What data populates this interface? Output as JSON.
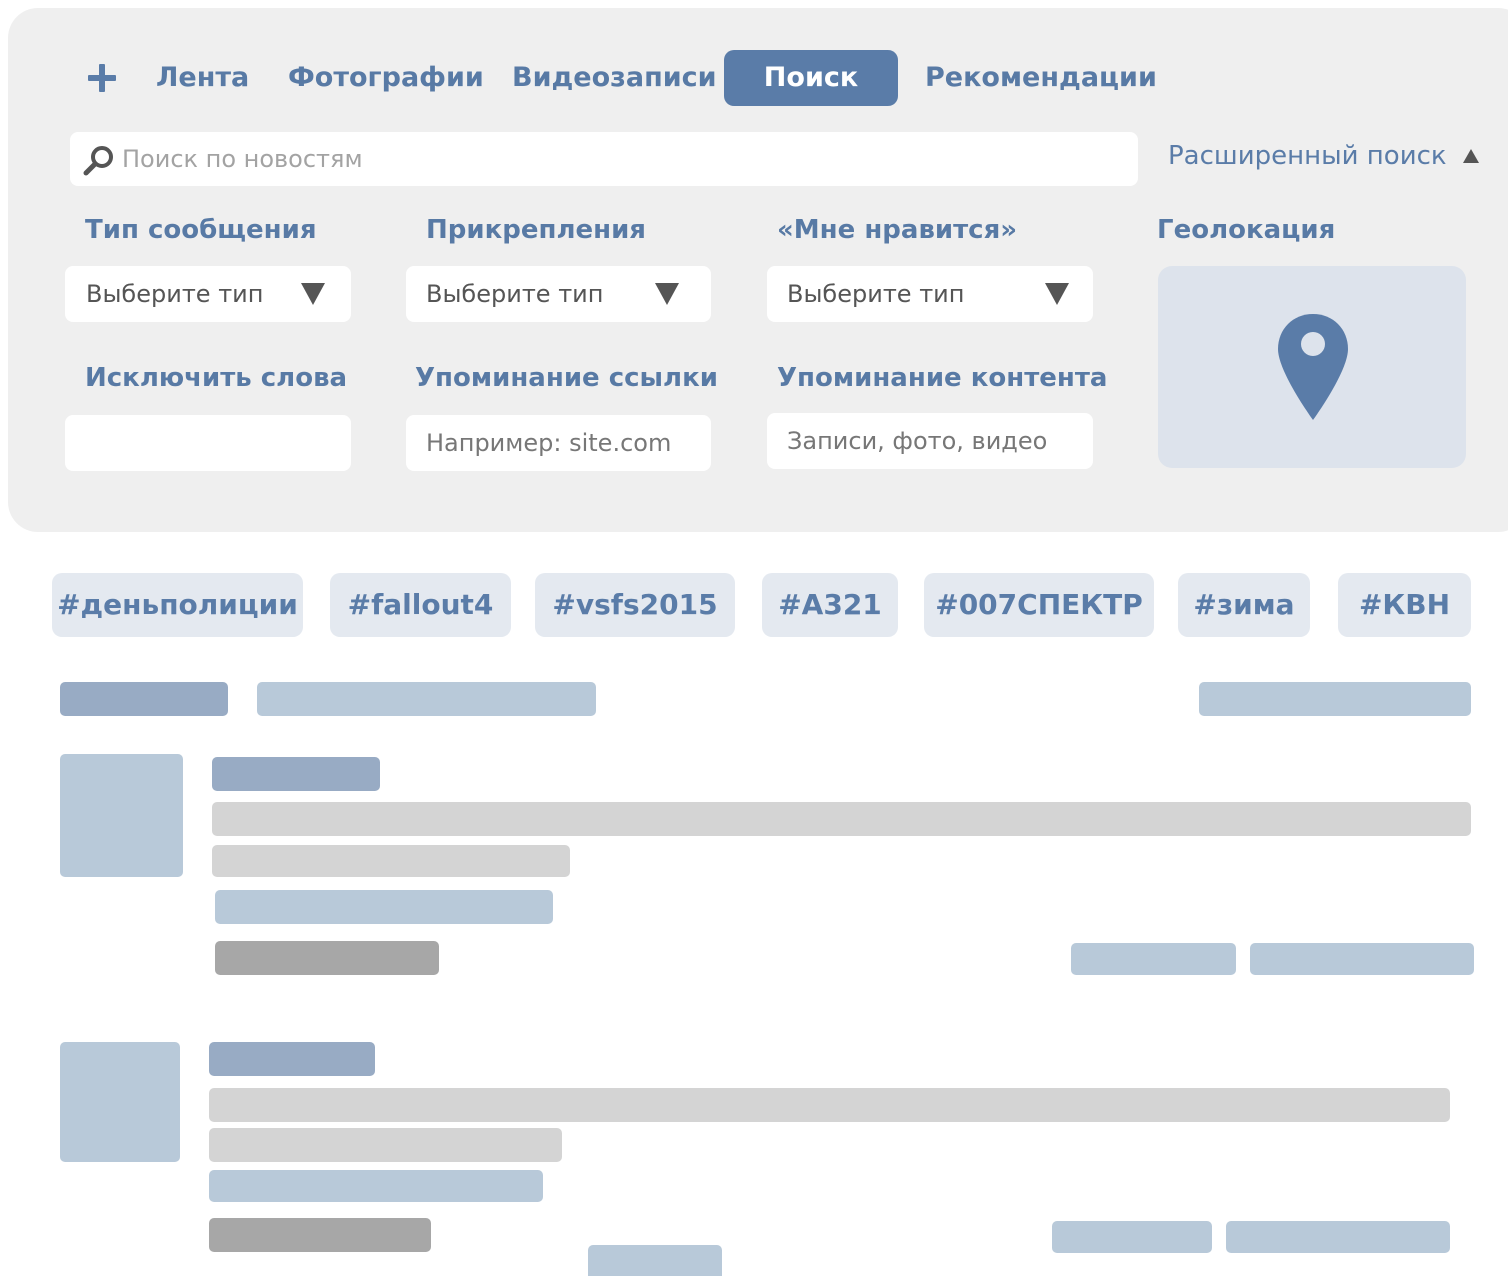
{
  "nav": {
    "add_icon": "plus-icon",
    "tabs": [
      {
        "label": "Лента",
        "active": false
      },
      {
        "label": "Фотографии",
        "active": false
      },
      {
        "label": "Видеозаписи",
        "active": false
      },
      {
        "label": "Поиск",
        "active": true
      },
      {
        "label": "Рекомендации",
        "active": false
      }
    ]
  },
  "search": {
    "placeholder": "Поиск по новостям",
    "icon": "search-icon",
    "advanced_label": "Расширенный поиск",
    "advanced_arrow": "triangle-up"
  },
  "filters": {
    "message_type": {
      "label": "Тип сообщения",
      "value": "Выберите тип"
    },
    "attachments": {
      "label": "Прикрепления",
      "value": "Выберите тип"
    },
    "likes": {
      "label": "«Мне нравится»",
      "value": "Выберите тип"
    },
    "geolocation": {
      "label": "Геолокация",
      "icon": "map-pin-icon"
    },
    "exclude_words": {
      "label": "Исключить слова",
      "placeholder": ""
    },
    "link_mention": {
      "label": "Упоминание ссылки",
      "placeholder": "Например: site.com"
    },
    "content_mention": {
      "label": "Упоминание контента",
      "placeholder": "Записи, фото, видео"
    }
  },
  "hashtags": [
    "#деньполиции",
    "#fallout4",
    "#vsfs2015",
    "#А321",
    "#007СПЕКТР",
    "#зима",
    "#КВН"
  ],
  "colors": {
    "accent": "#5a7ca8",
    "panel_bg": "#efefef",
    "tag_bg": "#e4e9f0",
    "geo_bg": "#dde3ec",
    "skeleton_dark": "#98abc4",
    "skeleton_light": "#b8c9d9",
    "skeleton_grey": "#d4d4d4",
    "skeleton_mid": "#a7a7a7"
  }
}
